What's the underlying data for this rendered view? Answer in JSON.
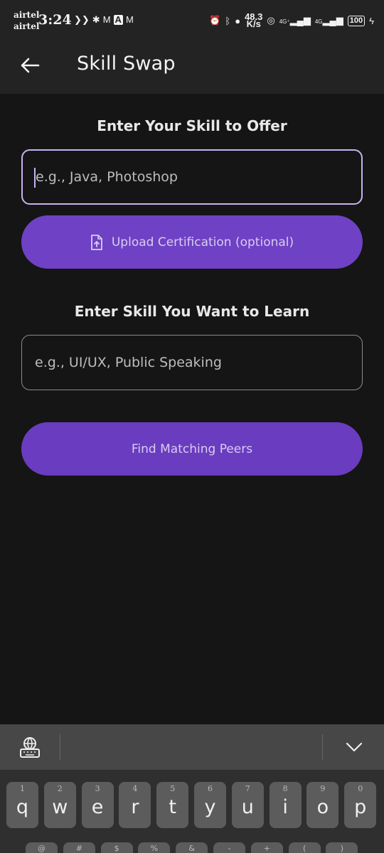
{
  "status_bar": {
    "carrier_1": "airtel",
    "carrier_2": "airtel",
    "time": "3:24",
    "notif_icons": [
      "vpn-icon",
      "puzzle-icon",
      "gmail-icon",
      "app-a-icon",
      "gmail-icon"
    ],
    "speed_value": "48.3",
    "speed_unit": "K/s",
    "net_1": "4G⁺",
    "net_2": "4G",
    "battery": "100"
  },
  "app_bar": {
    "title": "Skill Swap"
  },
  "offer": {
    "heading": "Enter Your Skill to Offer",
    "placeholder": "e.g., Java, Photoshop",
    "value": "",
    "upload_label": "Upload Certification (optional)"
  },
  "learn": {
    "heading": "Enter Skill You Want to Learn",
    "placeholder": "e.g., UI/UX, Public Speaking",
    "value": ""
  },
  "find_button": {
    "label": "Find Matching Peers"
  },
  "colors": {
    "accent": "#6a3cbf",
    "focus_border": "#c7b3f2",
    "background": "#151515",
    "app_bar": "#232323"
  },
  "keyboard": {
    "row1": [
      {
        "num": "1",
        "ch": "q"
      },
      {
        "num": "2",
        "ch": "w"
      },
      {
        "num": "3",
        "ch": "e"
      },
      {
        "num": "4",
        "ch": "r"
      },
      {
        "num": "5",
        "ch": "t"
      },
      {
        "num": "6",
        "ch": "y"
      },
      {
        "num": "7",
        "ch": "u"
      },
      {
        "num": "8",
        "ch": "i"
      },
      {
        "num": "9",
        "ch": "o"
      },
      {
        "num": "0",
        "ch": "p"
      }
    ],
    "row2_symbols": [
      "@",
      "#",
      "$",
      "%",
      "&",
      "-",
      "+",
      "(",
      ")"
    ]
  }
}
